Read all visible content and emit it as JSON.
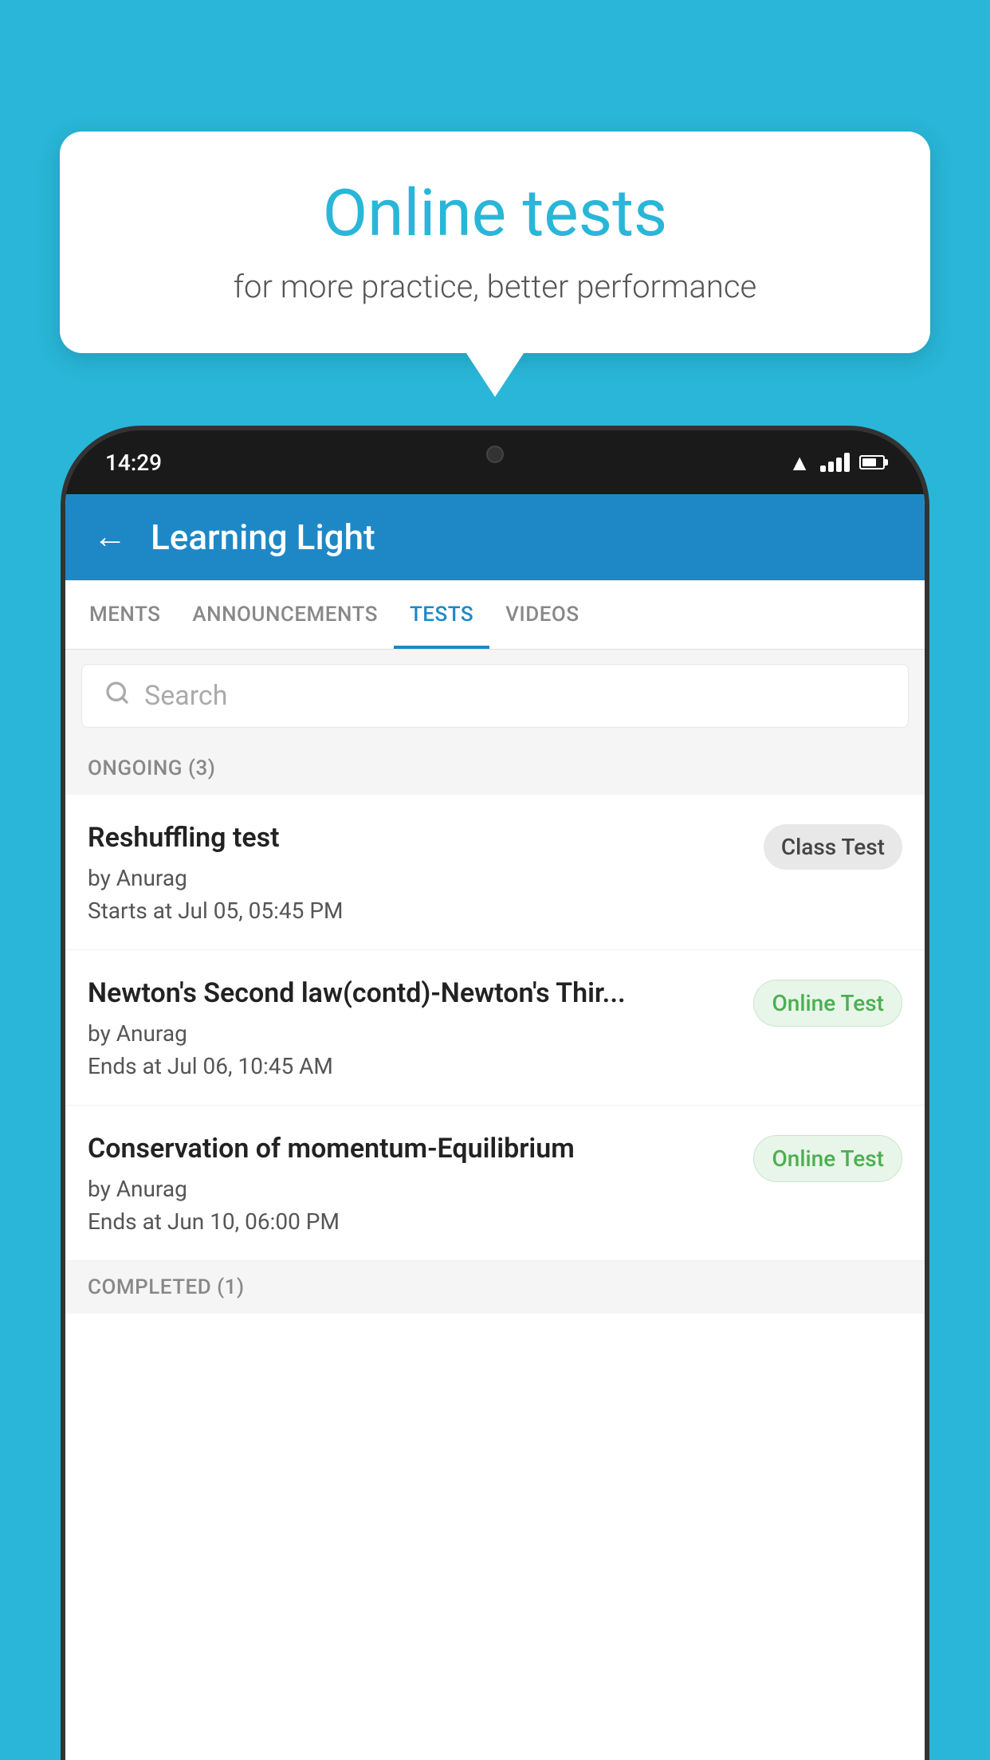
{
  "background": {
    "color": "#29b6d8"
  },
  "bubble": {
    "title": "Online tests",
    "subtitle": "for more practice, better performance"
  },
  "phone": {
    "status_bar": {
      "time": "14:29"
    },
    "header": {
      "title": "Learning Light",
      "back_label": "←"
    },
    "tabs": [
      {
        "label": "MENTS",
        "active": false
      },
      {
        "label": "ANNOUNCEMENTS",
        "active": false
      },
      {
        "label": "TESTS",
        "active": true
      },
      {
        "label": "VIDEOS",
        "active": false
      }
    ],
    "search": {
      "placeholder": "Search"
    },
    "ongoing_section": {
      "label": "ONGOING (3)"
    },
    "tests": [
      {
        "title": "Reshuffling test",
        "author": "by Anurag",
        "date": "Starts at  Jul 05, 05:45 PM",
        "badge": "Class Test",
        "badge_type": "class"
      },
      {
        "title": "Newton's Second law(contd)-Newton's Thir...",
        "author": "by Anurag",
        "date": "Ends at  Jul 06, 10:45 AM",
        "badge": "Online Test",
        "badge_type": "online"
      },
      {
        "title": "Conservation of momentum-Equilibrium",
        "author": "by Anurag",
        "date": "Ends at  Jun 10, 06:00 PM",
        "badge": "Online Test",
        "badge_type": "online"
      }
    ],
    "completed_section": {
      "label": "COMPLETED (1)"
    }
  }
}
